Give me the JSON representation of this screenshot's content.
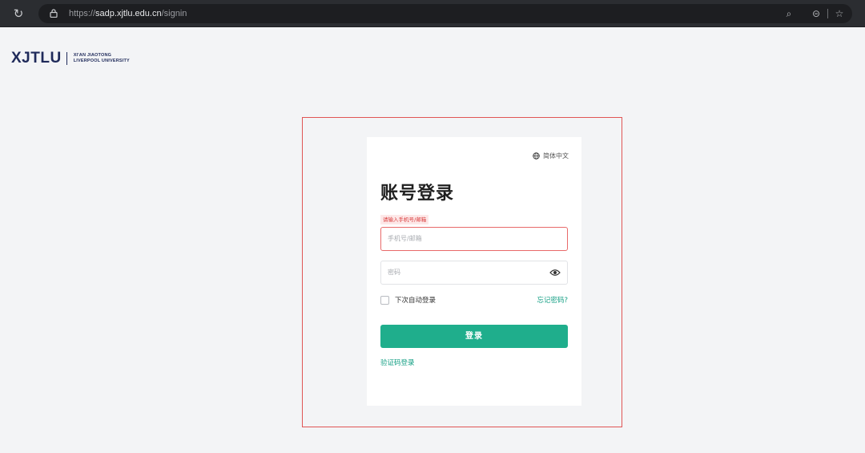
{
  "browser": {
    "url_scheme": "https://",
    "url_host": "sadp.xjtlu.edu.cn",
    "url_path": "/signin"
  },
  "logo": {
    "main": "XJTLU",
    "line1": "XI'AN JIAOTONG",
    "line2": "LIVERPOOL UNIVERSITY",
    "color": "#1f2a5a"
  },
  "login": {
    "language_label": "简体中文",
    "title": "账号登录",
    "error_message": "请输入手机号/邮箱",
    "account_placeholder": "手机号/邮箱",
    "password_placeholder": "密码",
    "remember_label": "下次自动登录",
    "forgot_label": "忘记密码?",
    "submit_label": "登录",
    "code_login_label": "验证码登录"
  },
  "colors": {
    "accent": "#1fae8c",
    "error": "#d93a3a",
    "highlight_frame": "#e05555"
  },
  "icons": {
    "reload": "reload-icon",
    "lock": "lock-icon",
    "zoom": "zoom-icon",
    "account": "account-icon",
    "bookmark": "star-icon",
    "globe": "globe-icon",
    "eye": "eye-icon"
  }
}
